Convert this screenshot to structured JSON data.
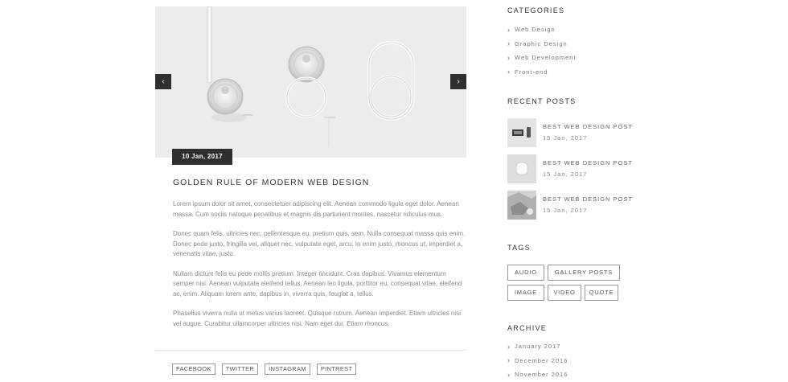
{
  "slider": {
    "prev_label": "‹",
    "next_label": "›"
  },
  "post": {
    "date": "10 Jan, 2017",
    "title": "GOLDEN RULE OF MODERN WEB DESIGN",
    "paragraphs": [
      "Lorem ipsum dolor sit amet, consectetuer adipiscing elit. Aenean commodo ligula eget dolor. Aenean massa. Cum sociis natoque penatibus et magnis dis parturient montes, nascetur ridiculus mus.",
      "Donec quam felis, ultricies nec, pellentesque eu, pretium quis, sem. Nulla consequat massa quis enim. Donec pede justo, fringilla vel, aliquet nec, vulputate eget, arcu. In enim justo, rhoncus ut, imperdiet a, venenatis vitae, justo.",
      "Nullam dictum felis eu pede mollis pretium. Integer tincidunt. Cras dapibus. Vivamus elementum semper nisi. Aenean vulputate eleifend tellus. Aenean leo ligula, porttitor eu, consequat vitae, eleifend ac, enim. Aliquam lorem ante, dapibus in, viverra quis, feugiat a, tellus.",
      "Phasellus viverra nulla ut metus varius laoreet. Quisque rutrum. Aenean imperdiet. Etiam ultricies nisi vel augue. Curabitur ullamcorper ultricies nisi. Nam eget dui. Etiam rhoncus."
    ],
    "share": [
      "FACEBOOK",
      "TWITTER",
      "INSTAGRAM",
      "PINTREST"
    ]
  },
  "sidebar": {
    "categories": {
      "heading": "CATEGORIES",
      "items": [
        "Web Design",
        "Graphic Design",
        "Web Development",
        "Front-end"
      ]
    },
    "recent_posts": {
      "heading": "RECENT POSTS",
      "items": [
        {
          "title": "BEST WEB DESIGN POST",
          "date": "15 Jan, 2017"
        },
        {
          "title": "BEST WEB DESIGN POST",
          "date": "15 Jan, 2017"
        },
        {
          "title": "BEST WEB DESIGN POST",
          "date": "15 Jan, 2017"
        }
      ]
    },
    "tags": {
      "heading": "TAGS",
      "items": [
        "AUDIO",
        "GALLERY POSTS",
        "IMAGE",
        "VIDEO",
        "QUOTE"
      ]
    },
    "archive": {
      "heading": "ARCHIVE",
      "items": [
        "January 2017",
        "December 2016",
        "November 2016"
      ]
    }
  },
  "colors": {
    "dark": "#2f2f2f",
    "background": "#ffffff",
    "image_bg": "#ececec"
  }
}
